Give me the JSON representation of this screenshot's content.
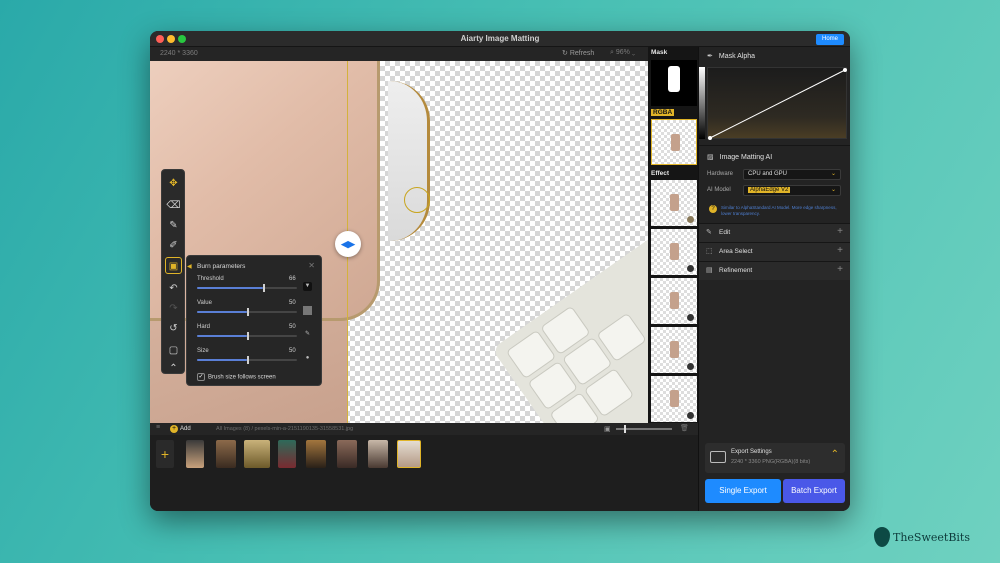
{
  "window": {
    "title": "Aiarty Image Matting",
    "home_label": "Home"
  },
  "toolbar": {
    "dimensions": "2240 * 3360",
    "refresh_label": "Refresh",
    "zoom": "96%"
  },
  "burn_panel": {
    "title": "Burn parameters",
    "sliders": [
      {
        "label": "Threshold",
        "value": "66",
        "fraction": 0.66
      },
      {
        "label": "Value",
        "value": "50",
        "fraction": 0.5
      },
      {
        "label": "Hard",
        "value": "50",
        "fraction": 0.5
      },
      {
        "label": "Size",
        "value": "50",
        "fraction": 0.5
      }
    ],
    "checkbox_label": "Brush size follows screen",
    "checkbox_checked": true
  },
  "thumbs": {
    "mask_label": "Mask",
    "rgba_label": "RGBA",
    "effect_label": "Effect"
  },
  "right_panel": {
    "mask_alpha_label": "Mask Alpha",
    "matting_title": "Image Matting AI",
    "hardware_label": "Hardware",
    "hardware_value": "CPU and GPU",
    "model_label": "AI Model",
    "model_value": "AlphaEdge  V2",
    "hint": "Similar to AlphaStandard AI Model. More edge sharpness, lower transparency.",
    "sections": [
      {
        "label": "Edit",
        "icon": "edit-icon"
      },
      {
        "label": "Area Select",
        "icon": "area-select-icon"
      },
      {
        "label": "Refinement",
        "icon": "refinement-icon"
      }
    ],
    "export_settings_title": "Export Settings",
    "export_settings_sub": "2240 * 3360 PNG(RGBA)(8 bits)",
    "single_export": "Single Export",
    "batch_export": "Batch Export"
  },
  "filmbar": {
    "add_label": "Add",
    "path": "All Images (8)  /  pexels-min-a-2151190135-31558531.jpg"
  },
  "brand": {
    "name": "TheSweetBits"
  },
  "colors": {
    "accent": "#e0b428",
    "blue": "#1e8bff",
    "batch": "#4a58e8"
  }
}
